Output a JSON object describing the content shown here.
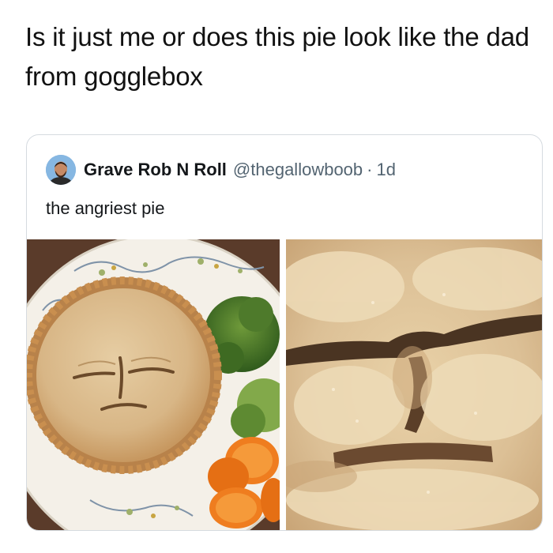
{
  "post": {
    "caption": "Is it just me or does this pie look like the dad from gogglebox"
  },
  "tweet": {
    "display_name": "Grave Rob N Roll",
    "handle": "@thegallowboob",
    "separator": "·",
    "time": "1d",
    "text": "the angriest pie",
    "avatar_icon": "profile-photo",
    "images": [
      "pie-on-plate-photo",
      "pie-face-closeup-photo"
    ]
  },
  "colors": {
    "name_text": "#14171a",
    "secondary_text": "#536471",
    "border": "#d6dbe0",
    "pie_crust": "#d8b88a"
  }
}
